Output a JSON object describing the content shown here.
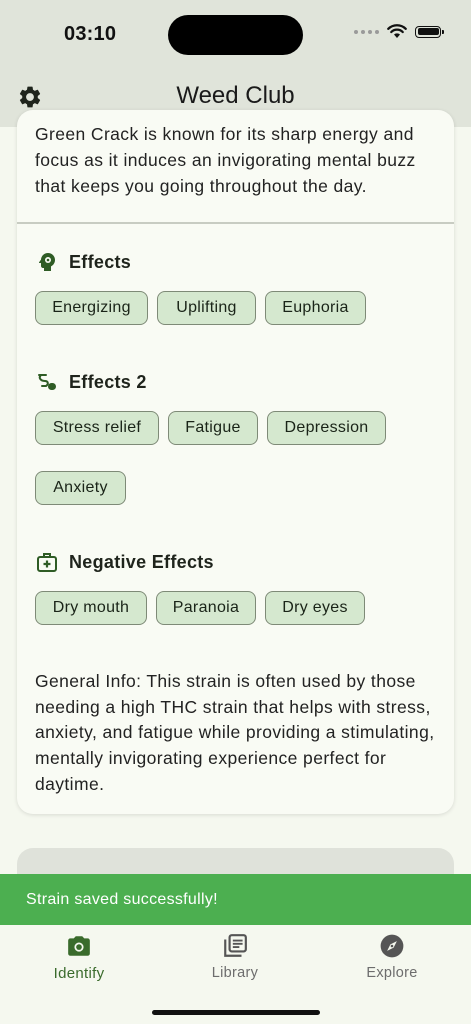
{
  "status_bar": {
    "time": "03:10"
  },
  "app_bar": {
    "title": "Weed Club",
    "settings_icon": "gear-icon"
  },
  "strain": {
    "description": "Green Crack is known for its sharp energy and focus as it induces an invigorating mental buzz that keeps you going throughout the day.",
    "sections": [
      {
        "title": "Effects",
        "icon": "brain-head-icon",
        "chips": [
          "Energizing",
          "Uplifting",
          "Euphoria"
        ]
      },
      {
        "title": "Effects 2",
        "icon": "medication-icon",
        "chips": [
          "Stress relief",
          "Fatigue",
          "Depression",
          "Anxiety"
        ]
      },
      {
        "title": "Negative Effects",
        "icon": "medical-kit-icon",
        "chips": [
          "Dry mouth",
          "Paranoia",
          "Dry eyes"
        ]
      }
    ],
    "general_info": "General Info: This strain is often used by those needing a high THC strain that helps with stress, anxiety, and fatigue while providing a stimulating, mentally invigorating experience perfect for daytime."
  },
  "snackbar": {
    "message": "Strain saved successfully!"
  },
  "bottom_nav": {
    "items": [
      {
        "label": "Identify",
        "icon": "camera-icon",
        "active": true
      },
      {
        "label": "Library",
        "icon": "library-icon",
        "active": false
      },
      {
        "label": "Explore",
        "icon": "compass-icon",
        "active": false
      }
    ]
  },
  "colors": {
    "primary": "#3a6b2c",
    "chip_bg": "#d5e8cf",
    "snackbar": "#4caf50",
    "app_bar": "#e0e4da",
    "background": "#f5f8ef"
  }
}
